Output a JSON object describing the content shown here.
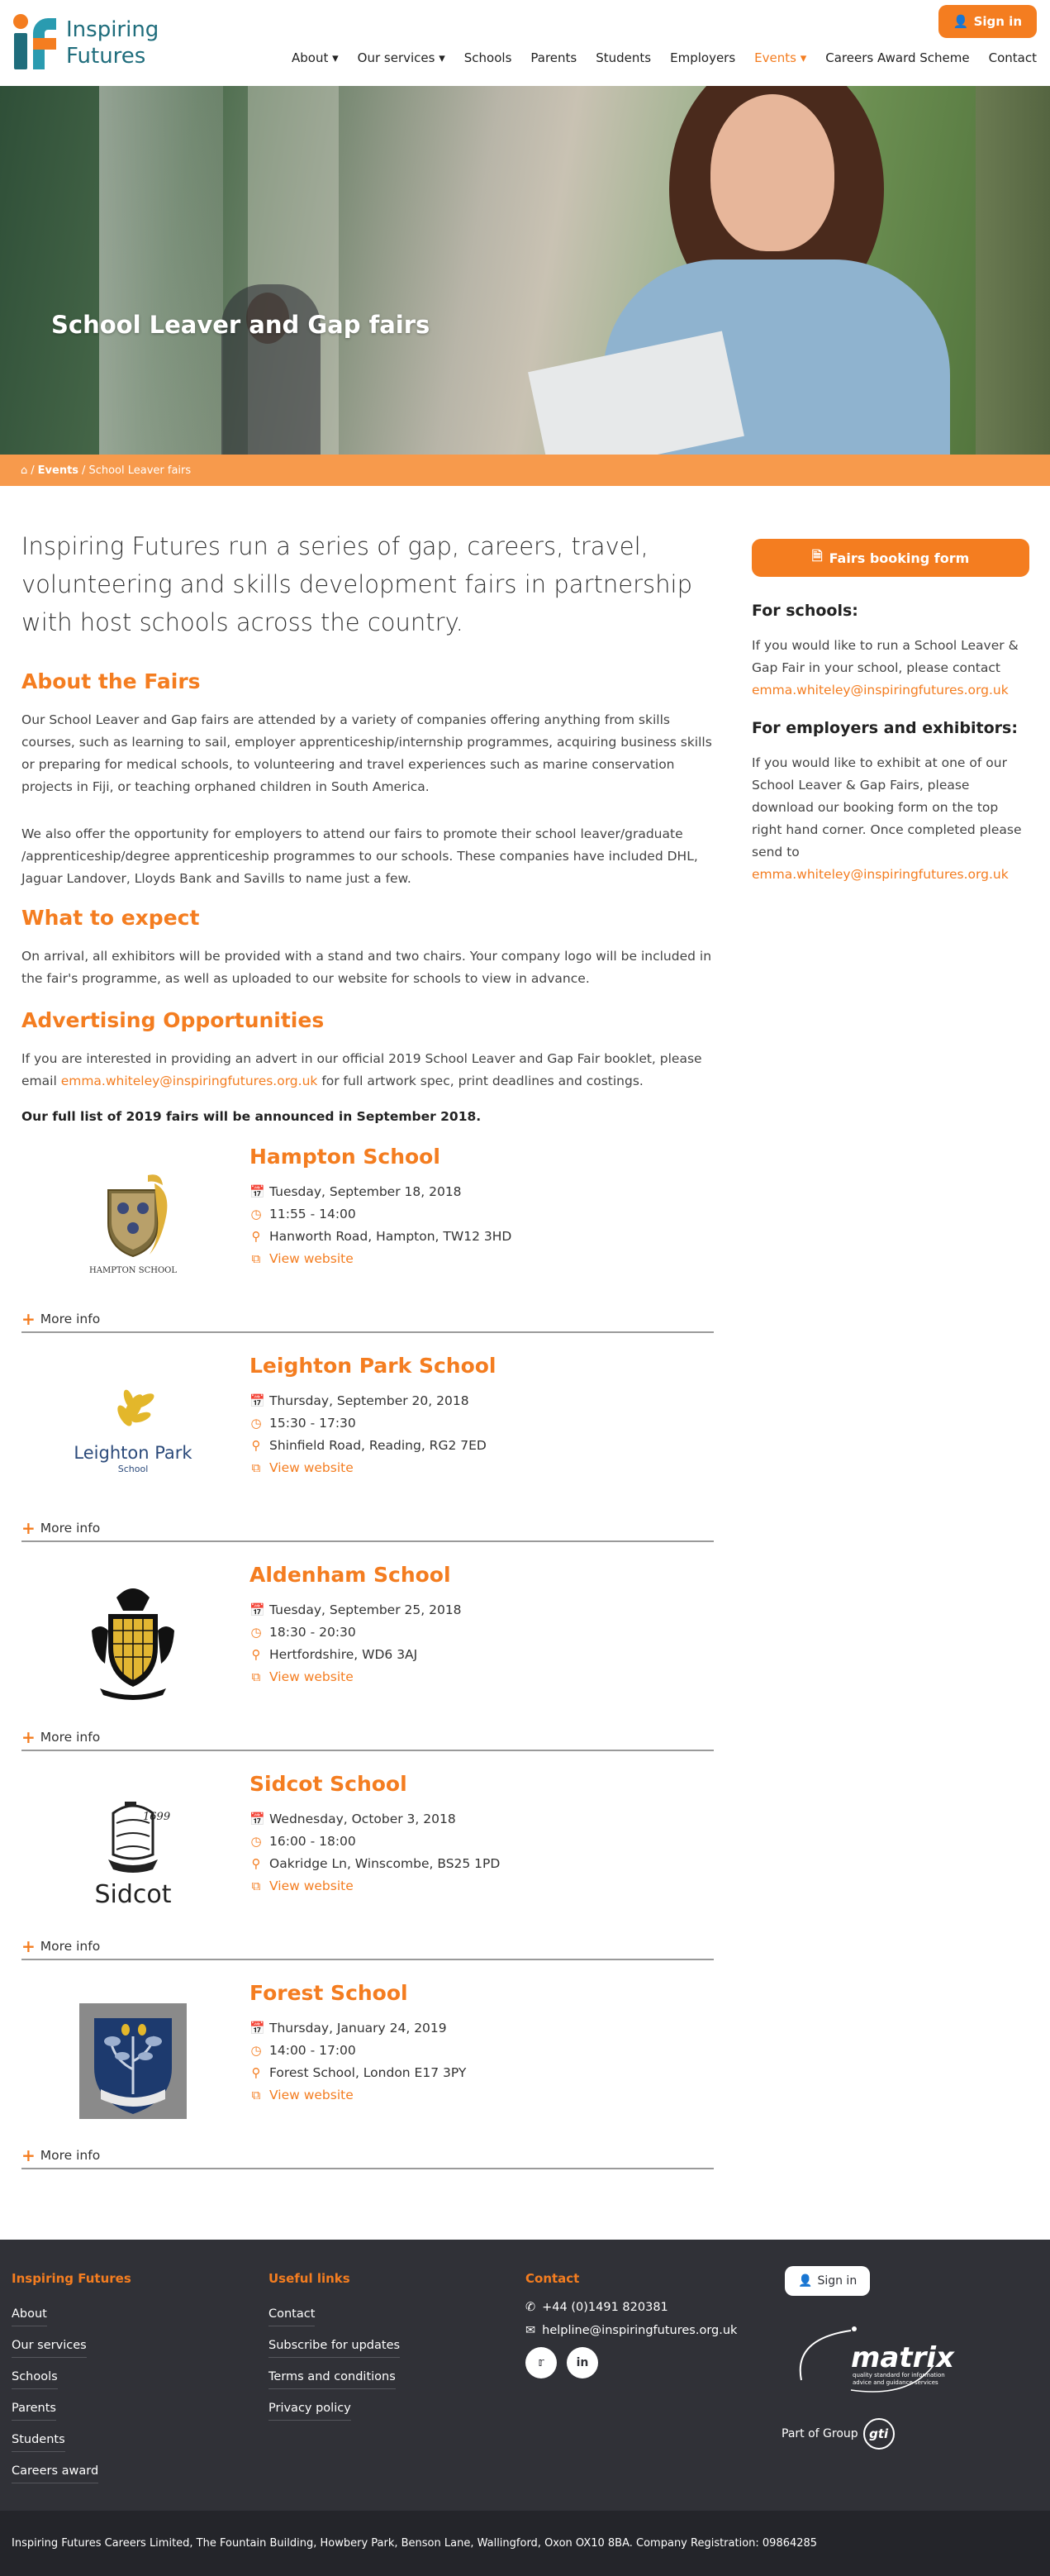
{
  "header": {
    "logo_line1": "Inspiring",
    "logo_line2": "Futures",
    "signin": "Sign in",
    "nav": [
      "About",
      "Our services",
      "Schools",
      "Parents",
      "Students",
      "Employers",
      "Events",
      "Careers Award Scheme",
      "Contact"
    ]
  },
  "hero": {
    "title": "School Leaver and Gap fairs"
  },
  "breadcrumb": {
    "home_icon": "home-icon",
    "events": "Events",
    "current": "School Leaver fairs",
    "sep": "/"
  },
  "main": {
    "intro": "Inspiring Futures run a series of gap, careers, travel, volunteering and skills development fairs in partnership with host schools across the country.",
    "about_heading": "About the Fairs",
    "about_p1": "Our School Leaver and Gap fairs are attended by a variety of companies offering anything from skills courses, such as learning to sail, employer apprenticeship/internship programmes, acquiring business skills or preparing for medical schools, to volunteering and travel experiences such as marine conservation projects in Fiji, or teaching orphaned children in South America.",
    "about_p2": "We also offer the opportunity for employers to attend our fairs to promote their school leaver/graduate /apprenticeship/degree apprenticeship programmes to our schools. These companies have included DHL, Jaguar Landover, Lloyds Bank and Savills to name just a few.",
    "expect_heading": "What to expect",
    "expect_p": "On arrival, all exhibitors will be provided with a stand and two chairs. Your company logo will be included in the fair's programme, as well as uploaded to our website for schools to view in advance.",
    "advert_heading": "Advertising Opportunities",
    "advert_p_before": "If you are interested in providing an advert in our official 2019 School Leaver and Gap Fair booklet, please email ",
    "advert_email": "emma.whiteley@inspiringfutures.org.uk",
    "advert_p_after": " for full artwork spec, print deadlines and costings.",
    "announce": "Our full list of 2019 fairs will be announced in September 2018.",
    "more_info": "More info",
    "view_website": "View website",
    "events": [
      {
        "name": "Hampton School",
        "date": "Tuesday, September 18, 2018",
        "time": "11:55 - 14:00",
        "address": "Hanworth Road, Hampton, TW12 3HD",
        "logo_caption": "HAMPTON SCHOOL"
      },
      {
        "name": "Leighton Park School",
        "date": "Thursday, September 20, 2018",
        "time": "15:30 - 17:30",
        "address": "Shinfield Road, Reading, RG2 7ED",
        "logo_caption": "Leighton Park",
        "logo_caption2": "School"
      },
      {
        "name": "Aldenham School",
        "date": "Tuesday, September 25, 2018",
        "time": "18:30 - 20:30",
        "address": "Hertfordshire, WD6 3AJ",
        "logo_caption": ""
      },
      {
        "name": "Sidcot School",
        "date": "Wednesday, October 3, 2018",
        "time": "16:00 - 18:00",
        "address": "Oakridge Ln, Winscombe, BS25 1PD",
        "logo_caption": "Sidcot",
        "logo_year": "1699"
      },
      {
        "name": "Forest School",
        "date": "Thursday, January 24, 2019",
        "time": "14:00 - 17:00",
        "address": "Forest School, London E17 3PY",
        "logo_caption": ""
      }
    ]
  },
  "sidebar": {
    "button": "Fairs booking form",
    "schools_heading": "For schools:",
    "schools_p": "If you would like to run a School Leaver & Gap Fair in your school, please contact",
    "schools_email": "emma.whiteley@inspiringfutures.org.uk",
    "employers_heading": "For employers and exhibitors:",
    "employers_p": "If you would like to exhibit at one of our School Leaver & Gap Fairs, please download our booking form on the top right hand corner. Once completed please send to",
    "employers_email": "emma.whiteley@inspiringfutures.org.uk"
  },
  "footer": {
    "col1_heading": "Inspiring Futures",
    "col1_links": [
      "About",
      "Our services",
      "Schools",
      "Parents",
      "Students",
      "Careers award"
    ],
    "col2_heading": "Useful links",
    "col2_links": [
      "Contact",
      "Subscribe for updates",
      "Terms and conditions",
      "Privacy policy"
    ],
    "col3_heading": "Contact",
    "phone": "+44 (0)1491 820381",
    "email": "helpline@inspiringfutures.org.uk",
    "signin": "Sign in",
    "matrix_word": "matrix",
    "matrix_tag1": "quality standard for information",
    "matrix_tag2": "advice and guidance services",
    "group_text": "Part of Group",
    "group_logo": "gti",
    "legal": "Inspiring Futures Careers Limited, The Fountain Building, Howbery Park, Benson Lane, Wallingford, Oxon OX10 8BA. Company Registration: 09864285"
  },
  "colors": {
    "accent": "#f47d20",
    "teal": "#1f6d7c",
    "footer_bg": "#303137",
    "breadcrumb_bg": "#f79a4c"
  }
}
